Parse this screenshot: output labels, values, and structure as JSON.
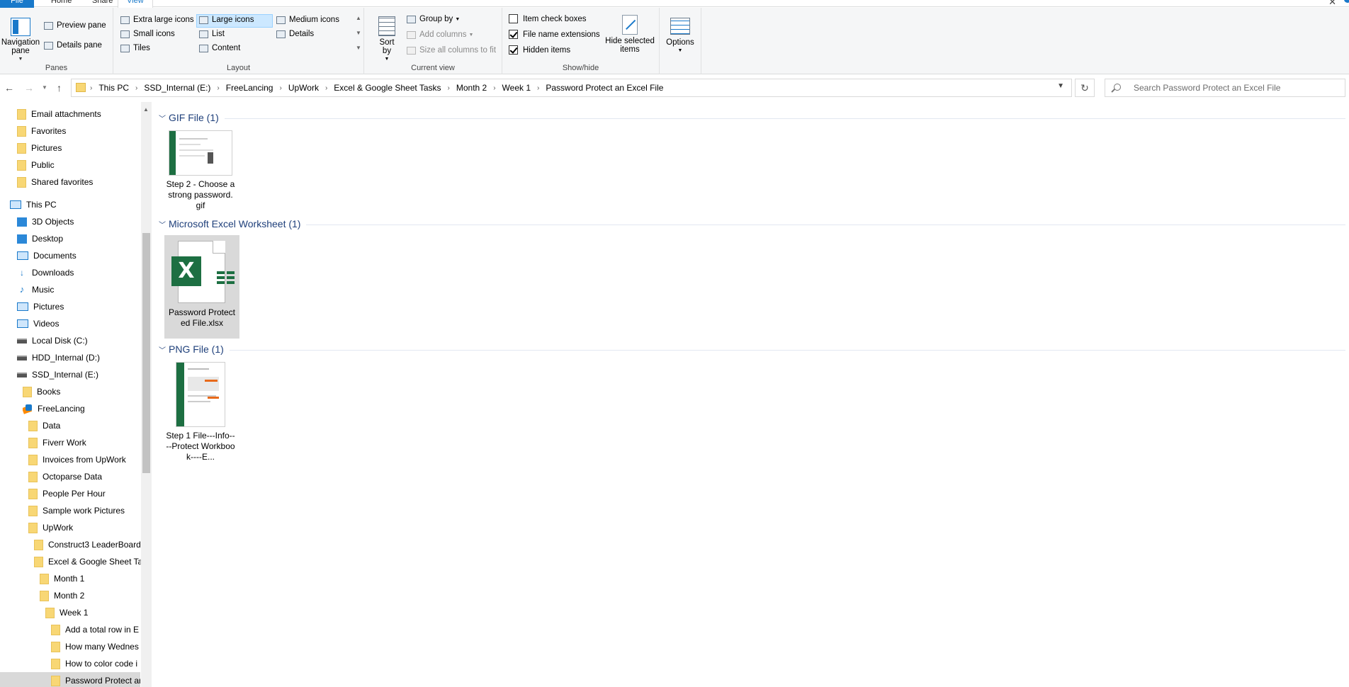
{
  "tabs": {
    "file": "File",
    "home": "Home",
    "share": "Share",
    "view": "View"
  },
  "window": {
    "close_glyph": "✕"
  },
  "ribbon": {
    "panes": {
      "label": "Panes",
      "navigation_pane": "Navigation pane",
      "preview_pane": "Preview pane",
      "details_pane": "Details pane"
    },
    "layout": {
      "label": "Layout",
      "options": [
        "Extra large icons",
        "Large icons",
        "Medium icons",
        "Small icons",
        "List",
        "Details",
        "Tiles",
        "Content"
      ],
      "selected": "Large icons"
    },
    "current_view": {
      "label": "Current view",
      "sort_by": "Sort by",
      "group_by": "Group by",
      "add_columns": "Add columns",
      "size_columns": "Size all columns to fit"
    },
    "show_hide": {
      "label": "Show/hide",
      "item_check_boxes": {
        "label": "Item check boxes",
        "checked": false
      },
      "file_name_extensions": {
        "label": "File name extensions",
        "checked": true
      },
      "hidden_items": {
        "label": "Hidden items",
        "checked": true
      },
      "hide_selected": "Hide selected items"
    },
    "options": "Options"
  },
  "address": {
    "breadcrumbs": [
      "This PC",
      "SSD_Internal (E:)",
      "FreeLancing",
      "UpWork",
      "Excel & Google Sheet Tasks",
      "Month 2",
      "Week 1",
      "Password Protect an Excel File"
    ],
    "search_placeholder": "Search Password Protect an Excel File"
  },
  "nav_tree": [
    {
      "label": "Email attachments",
      "icon": "folder-icon"
    },
    {
      "label": "Favorites",
      "icon": "folder-icon"
    },
    {
      "label": "Pictures",
      "icon": "folder-icon"
    },
    {
      "label": "Public",
      "icon": "folder-icon"
    },
    {
      "label": "Shared favorites",
      "icon": "folder-icon"
    },
    {
      "label": "This PC",
      "icon": "pc-icon"
    },
    {
      "label": "3D Objects",
      "icon": "objects-icon"
    },
    {
      "label": "Desktop",
      "icon": "desktop-icon"
    },
    {
      "label": "Documents",
      "icon": "documents-icon"
    },
    {
      "label": "Downloads",
      "icon": "download-icon"
    },
    {
      "label": "Music",
      "icon": "music-icon"
    },
    {
      "label": "Pictures",
      "icon": "pictures-icon"
    },
    {
      "label": "Videos",
      "icon": "videos-icon"
    },
    {
      "label": "Local Disk (C:)",
      "icon": "drive-icon"
    },
    {
      "label": "HDD_Internal (D:)",
      "icon": "drive-icon"
    },
    {
      "label": "SSD_Internal (E:)",
      "icon": "drive-icon"
    },
    {
      "label": "Books",
      "icon": "folder-icon"
    },
    {
      "label": "FreeLancing",
      "icon": "freelancing-icon"
    },
    {
      "label": "Data",
      "icon": "folder-icon"
    },
    {
      "label": "Fiverr Work",
      "icon": "folder-icon"
    },
    {
      "label": "Invoices from UpWork",
      "icon": "folder-icon"
    },
    {
      "label": "Octoparse Data",
      "icon": "folder-icon"
    },
    {
      "label": "People Per Hour",
      "icon": "folder-icon"
    },
    {
      "label": "Sample work Pictures",
      "icon": "folder-icon"
    },
    {
      "label": "UpWork",
      "icon": "folder-icon"
    },
    {
      "label": "Construct3 LeaderBoard",
      "icon": "folder-icon"
    },
    {
      "label": "Excel & Google Sheet Ta",
      "icon": "folder-icon"
    },
    {
      "label": "Month 1",
      "icon": "folder-icon"
    },
    {
      "label": "Month 2",
      "icon": "folder-icon"
    },
    {
      "label": "Week 1",
      "icon": "folder-icon"
    },
    {
      "label": "Add a total row in E",
      "icon": "folder-icon"
    },
    {
      "label": "How many Wednes",
      "icon": "folder-icon"
    },
    {
      "label": "How to color code i",
      "icon": "folder-icon"
    },
    {
      "label": "Password Protect ar",
      "icon": "folder-icon",
      "selected": true
    }
  ],
  "groups": [
    {
      "name": "GIF File (1)",
      "files": [
        {
          "name": "Step 2 - Choose a strong password.gif"
        }
      ]
    },
    {
      "name": "Microsoft Excel Worksheet (1)",
      "files": [
        {
          "name": "Password Protected File.xlsx",
          "selected": true
        }
      ]
    },
    {
      "name": "PNG File (1)",
      "files": [
        {
          "name": "Step 1 File---Info----Protect Workbook----E..."
        }
      ]
    }
  ],
  "colors": {
    "accent": "#1979ca",
    "excel_green": "#1d6f42",
    "group_header": "#1e3f7a",
    "folder": "#f8d775"
  }
}
